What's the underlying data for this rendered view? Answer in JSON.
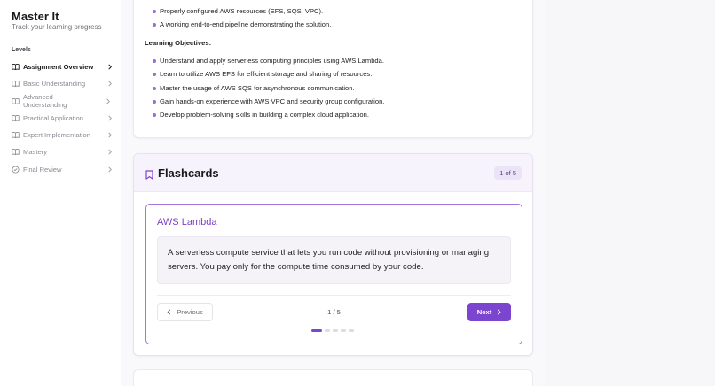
{
  "app": {
    "title": "Master It",
    "subtitle": "Track your learning progress"
  },
  "sidebar": {
    "section_label": "Levels",
    "items": [
      {
        "label": "Assignment Overview",
        "icon": "book-open-icon",
        "active": true
      },
      {
        "label": "Basic Understanding",
        "icon": "book-open-icon",
        "active": false
      },
      {
        "label": "Advanced Understanding",
        "icon": "book-open-icon",
        "active": false
      },
      {
        "label": "Practical Application",
        "icon": "book-open-icon",
        "active": false
      },
      {
        "label": "Expert Implementation",
        "icon": "book-open-icon",
        "active": false
      },
      {
        "label": "Mastery",
        "icon": "book-open-icon",
        "active": false
      },
      {
        "label": "Final Review",
        "icon": "check-circle-icon",
        "active": false
      }
    ]
  },
  "overview": {
    "deliverables": [
      "Properly configured AWS resources (EFS, SQS, VPC).",
      "A working end-to-end pipeline demonstrating the solution."
    ],
    "objectives_heading": "Learning Objectives:",
    "objectives": [
      "Understand and apply serverless computing principles using AWS Lambda.",
      "Learn to utilize AWS EFS for efficient storage and sharing of resources.",
      "Master the usage of AWS SQS for asynchronous communication.",
      "Gain hands-on experience with AWS VPC and security group configuration.",
      "Develop problem-solving skills in building a complex cloud application."
    ]
  },
  "flashcards": {
    "title": "Flashcards",
    "count_badge": "1 of 5",
    "term": "AWS Lambda",
    "definition": "A serverless compute service that lets you run code without provisioning or managing servers. You pay only for the compute time consumed by your code.",
    "prev_label": "Previous",
    "next_label": "Next",
    "page_indicator": "1 / 5",
    "total": 5,
    "current": 1
  },
  "colors": {
    "accent": "#7c45cf",
    "accent_light": "#f6f3fc",
    "bullet": "#9b6bd6"
  }
}
